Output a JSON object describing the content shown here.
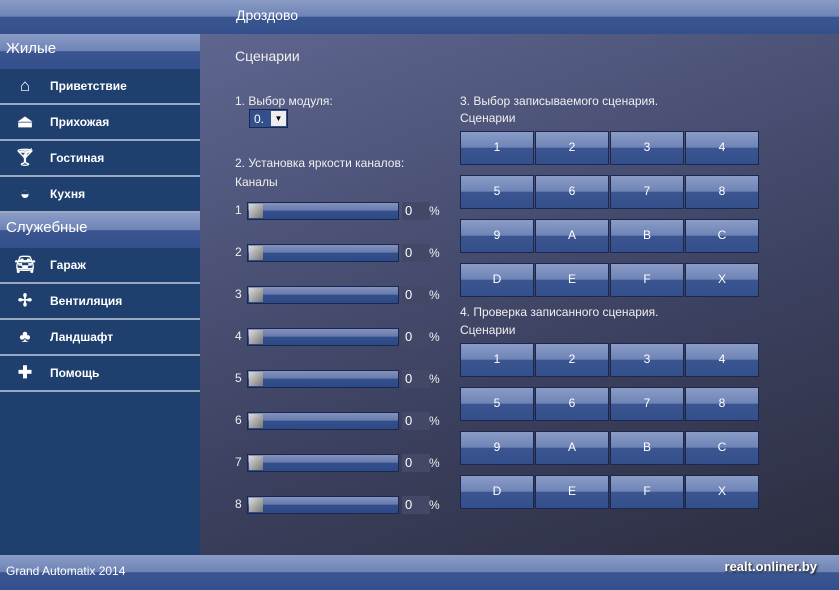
{
  "header": {
    "title": "Дроздово"
  },
  "sidebar": {
    "sections": [
      {
        "label": "Жилые",
        "items": [
          {
            "label": "Приветствие",
            "icon": "home-icon"
          },
          {
            "label": "Прихожая",
            "icon": "hanger-icon"
          },
          {
            "label": "Гостиная",
            "icon": "cocktail-icon"
          },
          {
            "label": "Кухня",
            "icon": "bowl-icon"
          }
        ]
      },
      {
        "label": "Служебные",
        "items": [
          {
            "label": "Гараж",
            "icon": "car-icon"
          },
          {
            "label": "Вентиляция",
            "icon": "fan-icon"
          },
          {
            "label": "Ландшафт",
            "icon": "tree-icon"
          },
          {
            "label": "Помощь",
            "icon": "help-cross-icon"
          }
        ]
      }
    ]
  },
  "main": {
    "title": "Сценарии",
    "module": {
      "label": "1. Выбор модуля:",
      "value": "0."
    },
    "brightness": {
      "label": "2. Установка яркости каналов:",
      "sub": "Каналы",
      "unit": "%",
      "channels": [
        {
          "n": "1",
          "v": "0"
        },
        {
          "n": "2",
          "v": "0"
        },
        {
          "n": "3",
          "v": "0"
        },
        {
          "n": "4",
          "v": "0"
        },
        {
          "n": "5",
          "v": "0"
        },
        {
          "n": "6",
          "v": "0"
        },
        {
          "n": "7",
          "v": "0"
        },
        {
          "n": "8",
          "v": "0"
        }
      ]
    },
    "record": {
      "label": "3. Выбор записываемого сценария.",
      "sub": "Сценарии"
    },
    "check": {
      "label": "4. Проверка записанного сценария.",
      "sub": "Сценарии"
    },
    "scenes": [
      "1",
      "2",
      "3",
      "4",
      "5",
      "6",
      "7",
      "8",
      "9",
      "A",
      "B",
      "C",
      "D",
      "E",
      "F",
      "X"
    ]
  },
  "footer": {
    "left": "Grand Automatix 2014",
    "right": "realt.onliner.by"
  }
}
